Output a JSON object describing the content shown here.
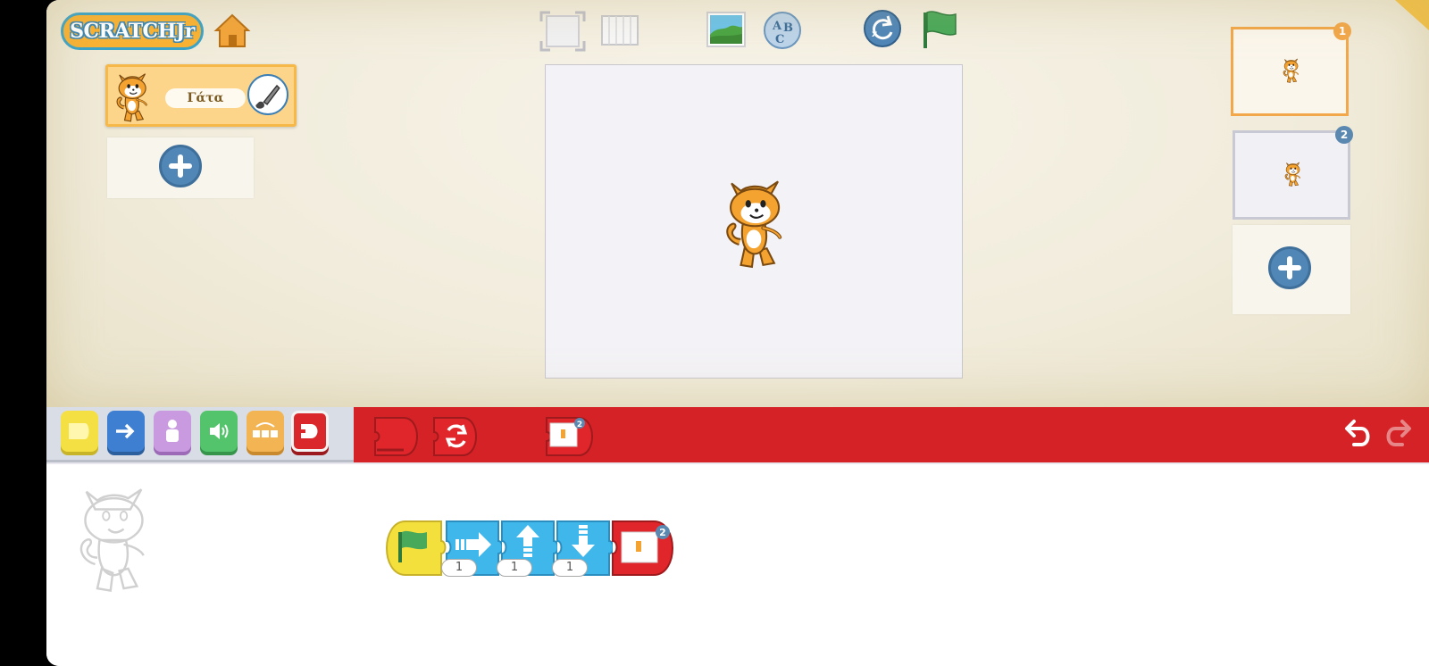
{
  "app": {
    "logo_text": "SCRATCHJr"
  },
  "toolbar": {
    "home": "home-icon",
    "fullscreen": "fullscreen-icon",
    "grid": "grid-icon",
    "background": "background-icon",
    "text": "text-icon",
    "reset": "reset-icon",
    "green_flag": "green-flag-icon"
  },
  "sprites": [
    {
      "name": "Γάτα",
      "selected": true
    }
  ],
  "pages": [
    {
      "number": "1",
      "selected": true
    },
    {
      "number": "2",
      "selected": false
    }
  ],
  "palette": {
    "categories": [
      "triggering",
      "motion",
      "looks",
      "sound",
      "control",
      "end"
    ],
    "active_category": "end",
    "blocks": [
      "end-block",
      "repeat-forever-block",
      "go-to-page-block"
    ],
    "go_to_page_number": "2"
  },
  "script": {
    "blocks": [
      {
        "type": "start-on-green-flag"
      },
      {
        "type": "move-right",
        "param": "1"
      },
      {
        "type": "move-up",
        "param": "1"
      },
      {
        "type": "move-down",
        "param": "1"
      },
      {
        "type": "go-to-page",
        "param": "2"
      }
    ]
  },
  "colors": {
    "palette_bar": "#d42226",
    "stage_bg": "#f3f2f6",
    "motion_blue": "#3fb7ea",
    "trigger_yellow": "#f5e043",
    "page_selected": "#f2a74a"
  }
}
